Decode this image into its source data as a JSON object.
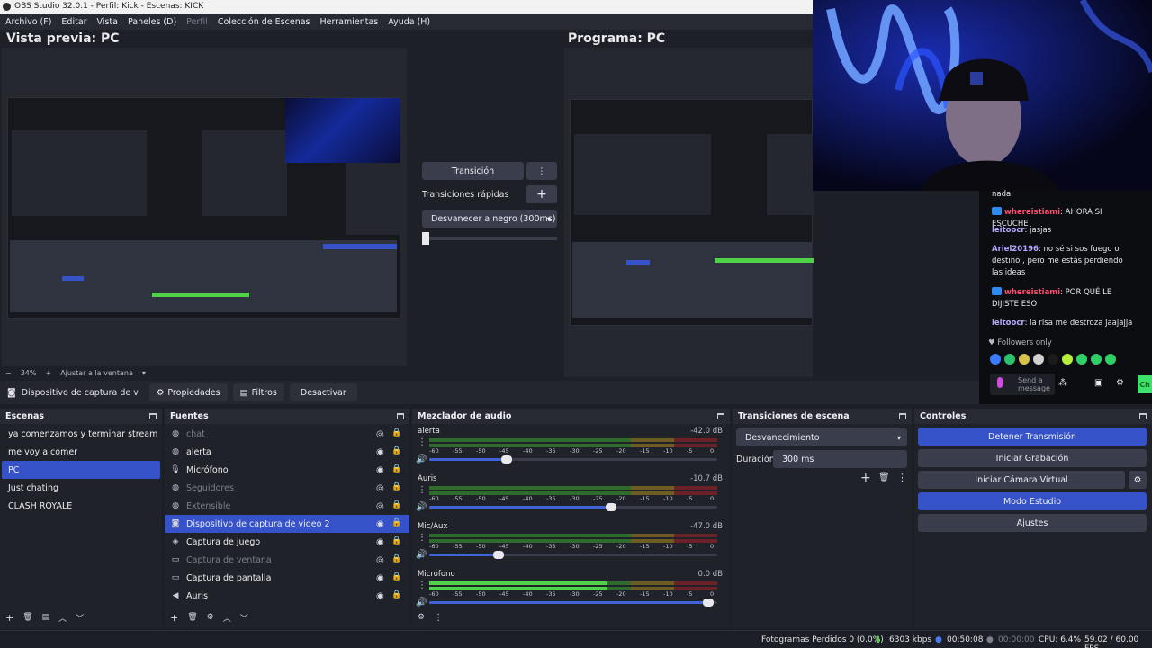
{
  "window": {
    "title": "OBS Studio 32.0.1 - Perfil: Kick - Escenas: KICK"
  },
  "menu": [
    "Archivo (F)",
    "Editar",
    "Vista",
    "Paneles (D)",
    "Perfil",
    "Colección de Escenas",
    "Herramientas",
    "Ayuda (H)"
  ],
  "preview": {
    "title": "Vista previa: PC",
    "zoom": "34%",
    "fit": "Ajustar a la ventana"
  },
  "program": {
    "title": "Programa: PC"
  },
  "transition": {
    "button": "Transición",
    "quick": "Transiciones rápidas",
    "selected": "Desvanecer a negro (300ms)"
  },
  "props": {
    "source": "Dispositivo de captura de v",
    "properties": "Propiedades",
    "filters": "Filtros",
    "deactivate": "Desactivar"
  },
  "scenes": {
    "title": "Escenas",
    "items": [
      "ya comenzamos y terminar stream",
      "me voy a comer",
      "PC",
      "Just chating",
      "CLASH ROYALE"
    ]
  },
  "sources": {
    "title": "Fuentes",
    "items": [
      "chat",
      "alerta",
      "Micrófono",
      "Seguidores",
      "Extensible",
      "Dispositivo de captura de video 2",
      "Captura de juego",
      "Captura de ventana",
      "Captura de pantalla",
      "Auris"
    ]
  },
  "mixer": {
    "title": "Mezclador de audio",
    "scale": [
      "-60",
      "-55",
      "-50",
      "-45",
      "-40",
      "-35",
      "-30",
      "-25",
      "-20",
      "-15",
      "-10",
      "-5",
      "0"
    ],
    "channels": [
      {
        "name": "alerta",
        "db": "-42.0 dB",
        "level": 0.0,
        "volume": 0.27
      },
      {
        "name": "Auris",
        "db": "-10.7 dB",
        "level": 0.0,
        "volume": 0.63
      },
      {
        "name": "Mic/Aux",
        "db": "-47.0 dB",
        "level": 0.0,
        "volume": 0.24
      },
      {
        "name": "Micrófono",
        "db": "0.0 dB",
        "level": 0.62,
        "volume": 0.97
      }
    ]
  },
  "scene_transitions": {
    "title": "Transiciones de escena",
    "selected": "Desvanecimiento",
    "duration_label": "Duración",
    "duration_value": "300 ms"
  },
  "controls": {
    "title": "Controles",
    "stop_stream": "Detener Transmisión",
    "start_record": "Iniciar Grabación",
    "virtual_cam": "Iniciar Cámara Virtual",
    "studio_mode": "Modo Estudio",
    "settings": "Ajustes"
  },
  "status": {
    "dropped": "Fotogramas Perdidos 0 (0.0%)",
    "bitrate": "6303 kbps",
    "stream_time": "00:50:08",
    "rec_time": "00:00:00",
    "cpu": "CPU: 6.4%",
    "fps": "59.02 / 60.00 FPS"
  },
  "chat": {
    "messages": [
      {
        "text": "nada"
      },
      {
        "user": "whereistiami",
        "text": "AHORA SI ESCUCHE"
      },
      {
        "user": "leitoocr",
        "text": "jasjas"
      },
      {
        "user": "Ariel20196",
        "text": "no sé si sos fuego o destino , pero me estás perdiendo las ideas"
      },
      {
        "user": "whereistiami",
        "text": "POR QUÉ LE DIJISTE ESO"
      },
      {
        "user": "leitoocr",
        "text": "la risa me destroza jaajajja"
      }
    ],
    "followers_only": "Followers only",
    "input_placeholder": "Send a message",
    "chat_button": "Ch"
  },
  "colors": {
    "accent": "#3652c8",
    "panel": "#1f2229",
    "header": "#272a33",
    "meter_green": "#4fd247"
  }
}
